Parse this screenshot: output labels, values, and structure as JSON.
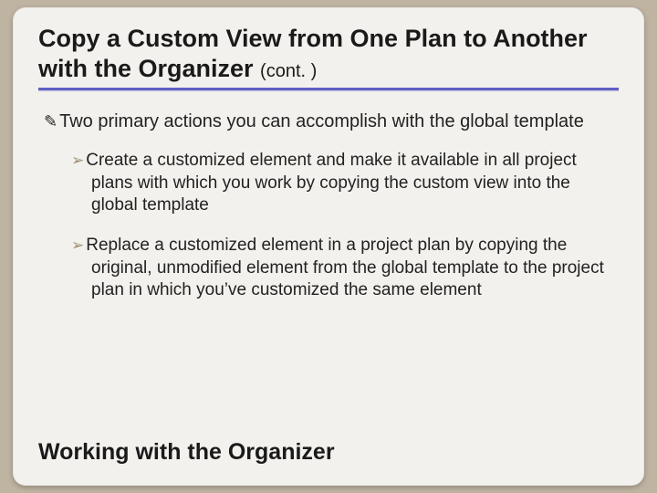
{
  "title": {
    "main": "Copy a Custom View from One Plan to Another with the Organizer",
    "cont": "(cont. )"
  },
  "bullets": {
    "lvl1_glyph": "✎",
    "lvl2_glyph": "➢",
    "intro": "Two primary actions you can accomplish with the global template",
    "items": [
      "Create a customized element and make it available in all project plans with which you work by copying the custom view into the global template",
      "Replace a customized element in a project plan by copying the original, unmodified element from the global template to the project plan in which you’ve customized the same element"
    ]
  },
  "footer": "Working with the Organizer"
}
